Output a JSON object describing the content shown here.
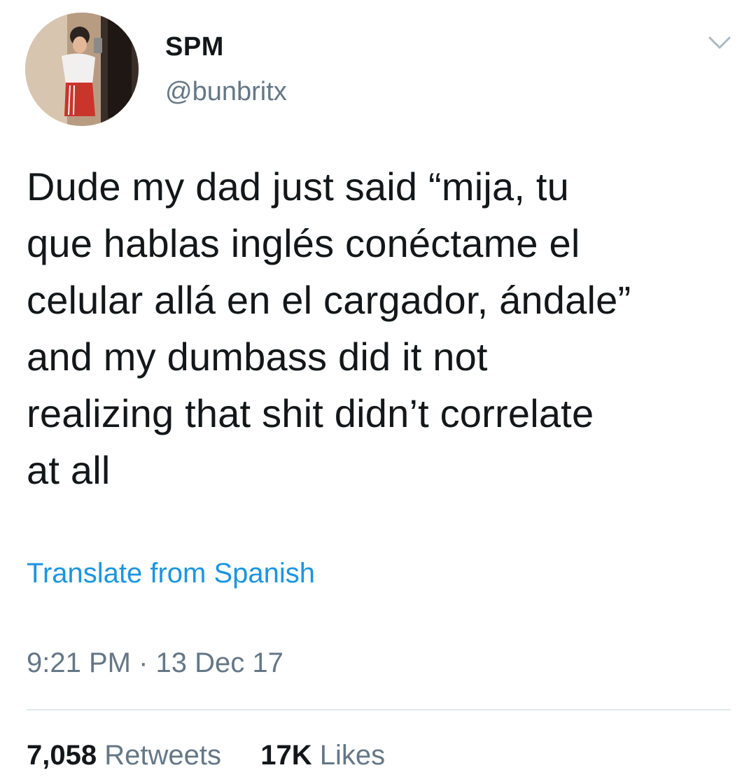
{
  "tweet": {
    "author": {
      "display_name": "SPM",
      "handle": "@bunbritx"
    },
    "text": "Dude my dad just said  “mija, tu\nque hablas inglés conéctame el\ncelular allá en el cargador, ándale”\nand my dumbass did it not\nrealizing that shit didn’t correlate\nat all",
    "translate_label": "Translate from Spanish",
    "time": "9:21 PM",
    "separator": "·",
    "date": "13 Dec 17",
    "retweets": {
      "count": "7,058",
      "label": "Retweets"
    },
    "likes": {
      "count": "17K",
      "label": "Likes"
    }
  },
  "colors": {
    "text": "#14171a",
    "secondary": "#657786",
    "link": "#1b95e0",
    "divider": "#e1e8ed"
  },
  "icons": {
    "menu_caret": "chevron-down-icon"
  }
}
